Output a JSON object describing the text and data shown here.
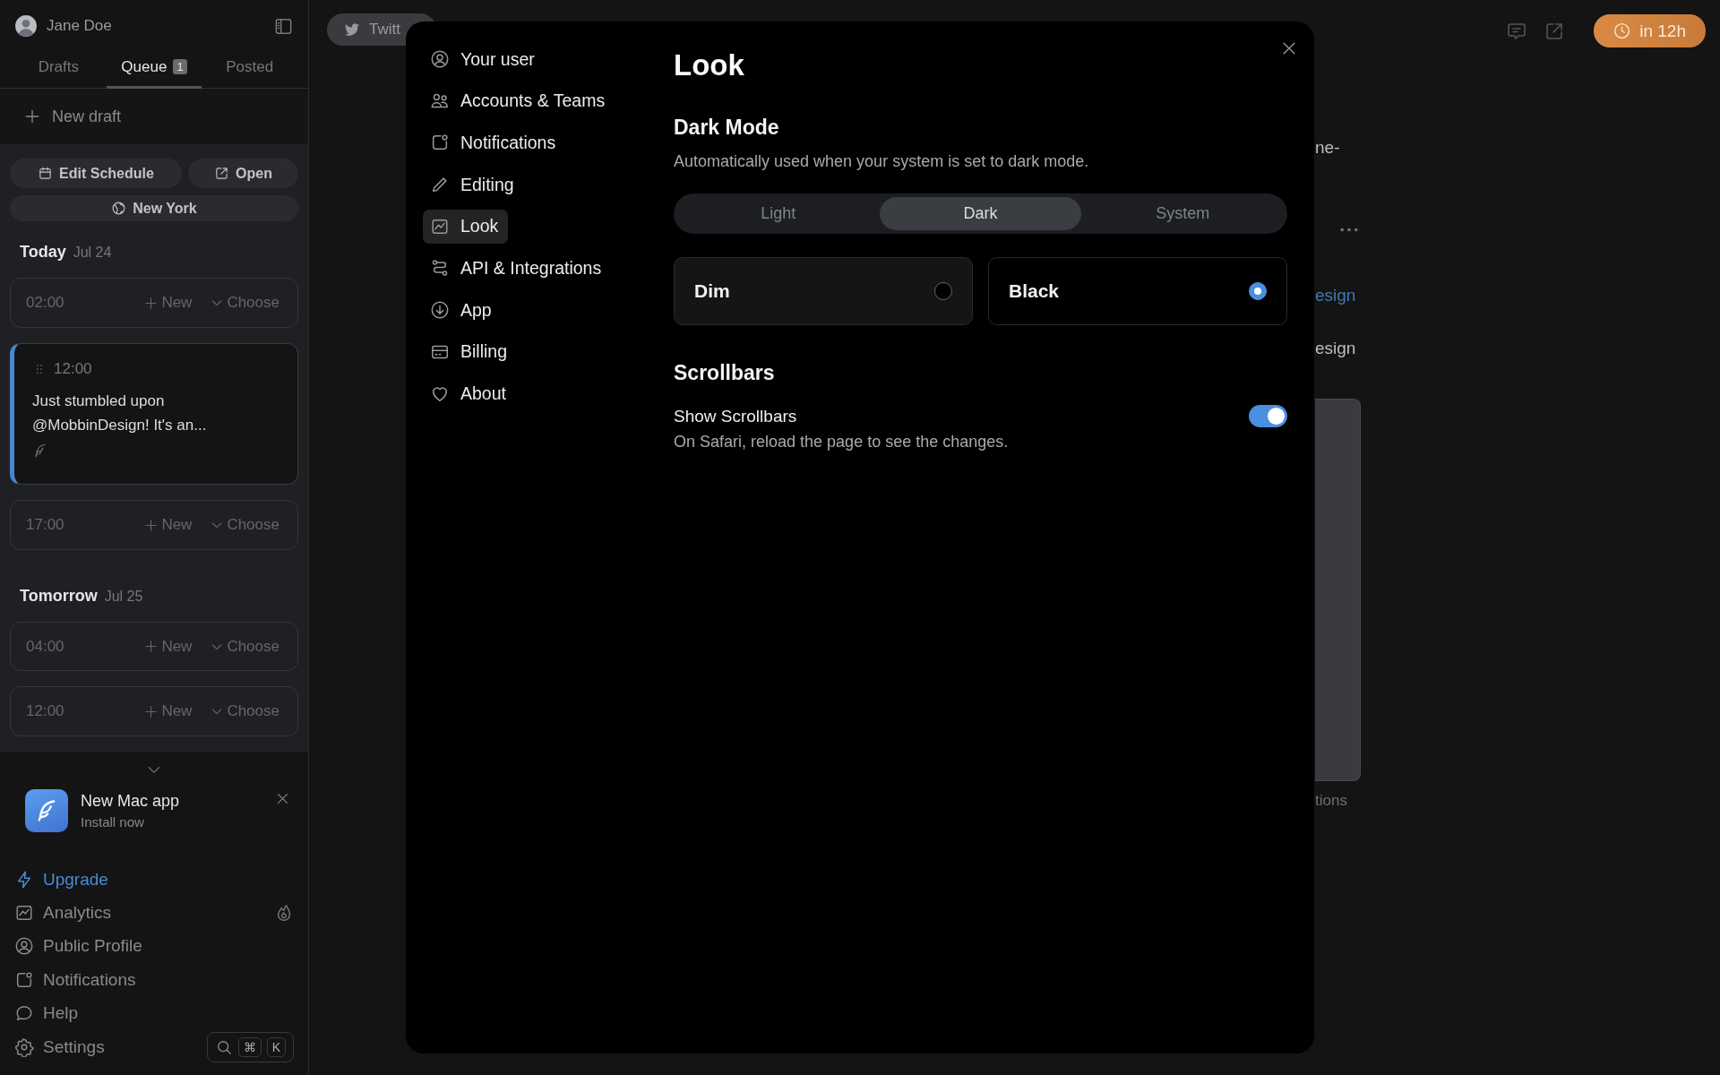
{
  "sidebar": {
    "user": {
      "name": "Jane Doe"
    },
    "tabs": [
      {
        "label": "Drafts",
        "selected": false
      },
      {
        "label": "Queue",
        "badge": "1",
        "selected": true
      },
      {
        "label": "Posted",
        "selected": false
      }
    ],
    "new_draft": "New draft",
    "schedule_buttons": [
      "Edit Schedule",
      "Open"
    ],
    "timezone": "New York",
    "days": [
      {
        "label": "Today",
        "date": "Jul 24",
        "slots": [
          {
            "kind": "empty",
            "time": "02:00",
            "new": "New",
            "choose": "Choose"
          },
          {
            "kind": "post",
            "time": "12:00",
            "text": "Just stumbled upon @MobbinDesign! It's an..."
          },
          {
            "kind": "empty",
            "time": "17:00",
            "new": "New",
            "choose": "Choose"
          }
        ]
      },
      {
        "label": "Tomorrow",
        "date": "Jul 25",
        "slots": [
          {
            "kind": "empty",
            "time": "04:00",
            "new": "New",
            "choose": "Choose"
          },
          {
            "kind": "empty",
            "time": "12:00",
            "new": "New",
            "choose": "Choose"
          }
        ]
      }
    ],
    "promo": {
      "title": "New Mac app",
      "subtitle": "Install now"
    },
    "nav": [
      {
        "label": "Upgrade",
        "kind": "upgrade"
      },
      {
        "label": "Analytics",
        "kind": "link"
      },
      {
        "label": "Public Profile",
        "kind": "link"
      },
      {
        "label": "Notifications",
        "kind": "link"
      },
      {
        "label": "Help",
        "kind": "link"
      },
      {
        "label": "Settings",
        "kind": "link"
      }
    ],
    "shortcut": {
      "keys": [
        "⌘",
        "K"
      ]
    }
  },
  "main": {
    "channel_chip": "Twitt",
    "fragments": [
      {
        "kind": "text",
        "text": "ne-"
      },
      {
        "kind": "more"
      },
      {
        "kind": "link",
        "text": "esign"
      },
      {
        "kind": "text",
        "text": "esign"
      },
      {
        "kind": "image"
      },
      {
        "kind": "muted",
        "text": "tions"
      }
    ],
    "schedule_pill": "in 12h"
  },
  "settings_modal": {
    "nav": [
      {
        "label": "Your user",
        "selected": false
      },
      {
        "label": "Accounts & Teams",
        "selected": false
      },
      {
        "label": "Notifications",
        "selected": false
      },
      {
        "label": "Editing",
        "selected": false
      },
      {
        "label": "Look",
        "selected": true
      },
      {
        "label": "API & Integrations",
        "selected": false
      },
      {
        "label": "App",
        "selected": false
      },
      {
        "label": "Billing",
        "selected": false
      },
      {
        "label": "About",
        "selected": false
      }
    ],
    "title": "Look",
    "dark_mode": {
      "heading": "Dark Mode",
      "description": "Automatically used when your system is set to dark mode.",
      "modes": [
        {
          "label": "Light",
          "selected": false
        },
        {
          "label": "Dark",
          "selected": true
        },
        {
          "label": "System",
          "selected": false
        }
      ],
      "themes": [
        {
          "label": "Dim",
          "selected": false
        },
        {
          "label": "Black",
          "selected": true
        }
      ]
    },
    "scrollbars": {
      "heading": "Scrollbars",
      "label": "Show Scrollbars",
      "description": "On Safari, reload the page to see the changes.",
      "on": true
    }
  }
}
